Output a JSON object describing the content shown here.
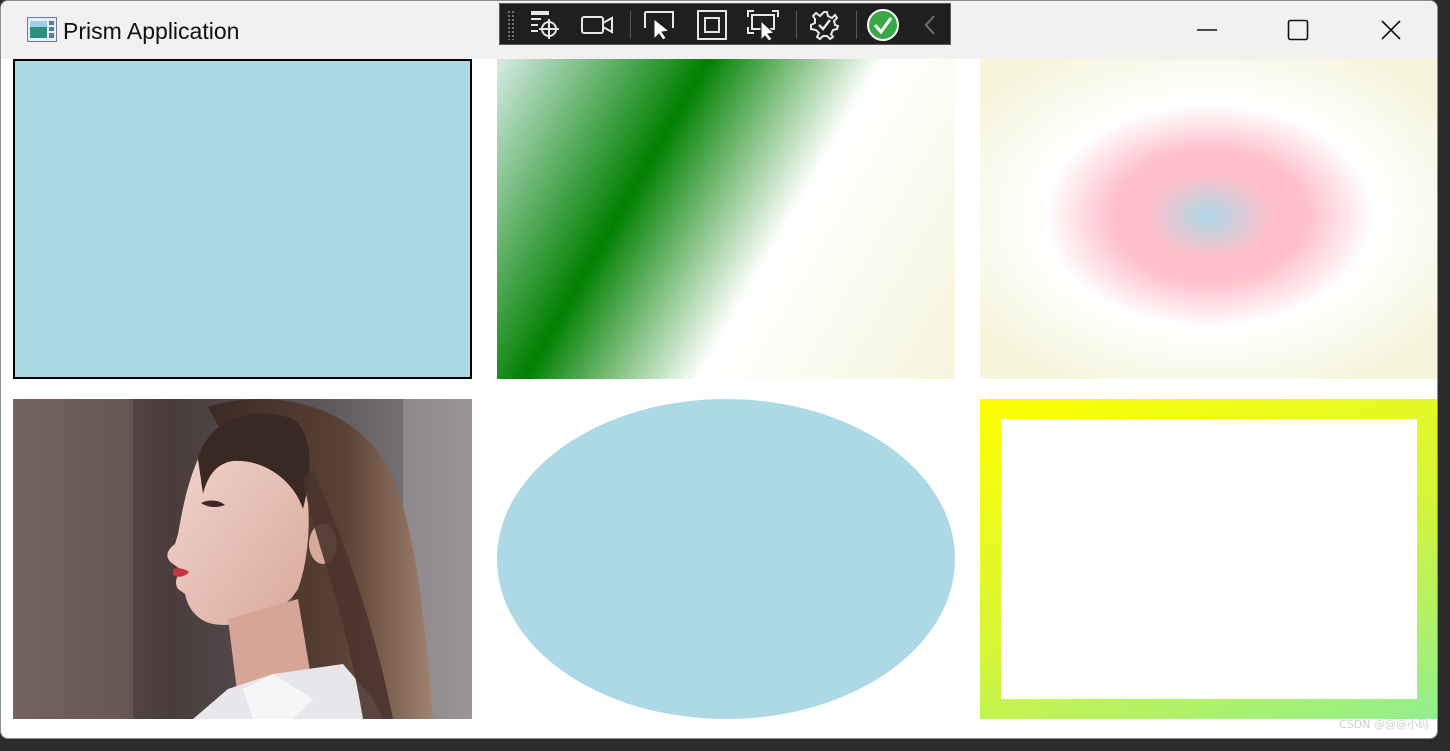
{
  "window": {
    "title": "Prism Application",
    "app_icon": "app-window-icon",
    "controls": [
      {
        "name": "minimize",
        "icon": "minimize-icon"
      },
      {
        "name": "maximize",
        "icon": "maximize-icon"
      },
      {
        "name": "close",
        "icon": "close-icon"
      }
    ]
  },
  "debug_toolbar": {
    "tools": [
      {
        "name": "go-to-live-visual-tree",
        "icon": "visual-tree-target-icon"
      },
      {
        "name": "show-in-application",
        "icon": "video-camera-icon"
      },
      {
        "name": "select-element",
        "icon": "cursor-select-icon"
      },
      {
        "name": "display-layout-adorners",
        "icon": "layout-adorner-icon"
      },
      {
        "name": "track-focused-element",
        "icon": "track-focus-icon"
      },
      {
        "name": "hot-reload",
        "icon": "hot-reload-gear-icon"
      },
      {
        "name": "binding-status",
        "icon": "check-circle-icon"
      },
      {
        "name": "collapse",
        "icon": "chevron-left-icon"
      }
    ]
  },
  "shapes": [
    {
      "name": "rectangle-solid",
      "fill": "#ADD8E6",
      "stroke": "#000000"
    },
    {
      "name": "rectangle-linear-gradient",
      "stops": [
        "#ADD8E6",
        "#008000",
        "#FFFFFF",
        "#F5F5DC"
      ]
    },
    {
      "name": "rectangle-radial-gradient",
      "stops": [
        "#ADD8E6",
        "#FFC0CB",
        "#FFFFFF",
        "#F5F5DC"
      ]
    },
    {
      "name": "image-brush-portrait"
    },
    {
      "name": "ellipse-solid",
      "fill": "#ADD8E6"
    },
    {
      "name": "rectangle-gradient-border",
      "stops": [
        "#FFFF00",
        "#90EE90"
      ],
      "fill": "#FFFFFF"
    }
  ],
  "watermark": "CSDN @@@小码"
}
